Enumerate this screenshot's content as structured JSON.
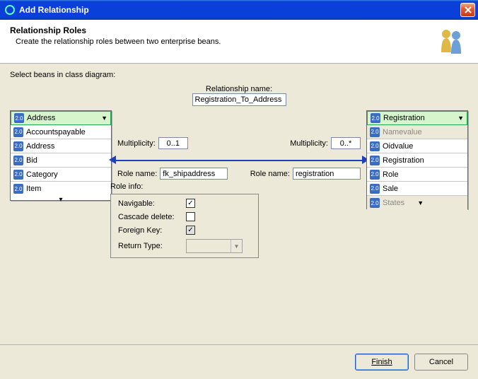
{
  "titlebar": {
    "title": "Add Relationship"
  },
  "header": {
    "title": "Relationship Roles",
    "subtitle": "Create the relationship roles between two enterprise beans."
  },
  "instruction": "Select beans in class diagram:",
  "relationship": {
    "label": "Relationship name:",
    "value": "Registration_To_Address"
  },
  "left_list": {
    "selected": "Address",
    "items": [
      "Accountspayable",
      "Address",
      "Bid",
      "Category",
      "Item"
    ]
  },
  "right_list": {
    "selected": "Registration",
    "dim_item": "Namevalue",
    "items": [
      "Oidvalue",
      "Registration",
      "Role",
      "Sale"
    ],
    "dim_bottom": "States"
  },
  "association": {
    "mult_label": "Multiplicity:",
    "role_label": "Role name:",
    "left_mult": "0..1",
    "right_mult": "0..*",
    "left_role": "fk_shipaddress",
    "right_role": "registration"
  },
  "role_info": {
    "title": "Role info:",
    "navigable_label": "Navigable:",
    "cascade_label": "Cascade delete:",
    "fk_label": "Foreign Key:",
    "return_label": "Return Type:",
    "navigable_checked": "✓",
    "fk_checked": "✓"
  },
  "buttons": {
    "finish": "Finish",
    "cancel": "Cancel"
  }
}
